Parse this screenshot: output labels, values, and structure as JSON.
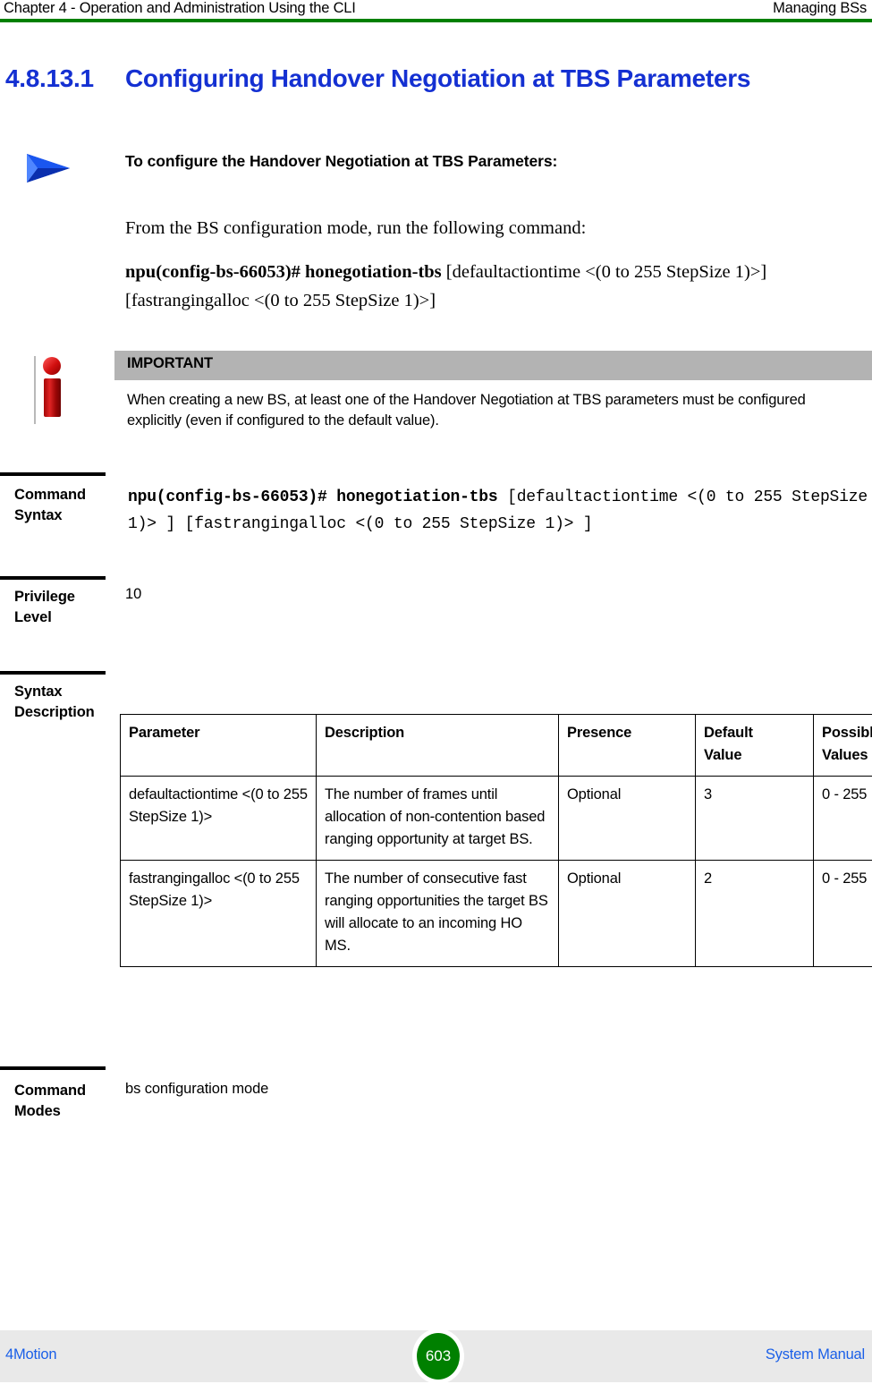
{
  "header": {
    "left": "Chapter 4 - Operation and Administration Using the CLI",
    "right": "Managing BSs",
    "rule_color": "#008000"
  },
  "section": {
    "number": "4.8.13.1",
    "title": "Configuring Handover Negotiation at TBS Parameters",
    "color": "#1430d2"
  },
  "procedure": {
    "arrow_icon": "blue-arrow-icon",
    "title": "To configure the Handover Negotiation at TBS Parameters:",
    "intro": "From the BS configuration mode, run the following command:",
    "command_bold": "npu(config-bs-66053)# honegotiation-tbs",
    "command_rest": " [defaultactiontime <(0 to 255 StepSize 1)>] [fastrangingalloc <(0 to 255 StepSize 1)>]"
  },
  "important_note": {
    "icon": "red-info-icon",
    "label": "IMPORTANT",
    "band_color": "#b3b3b3",
    "body": "When creating a new BS, at least one of the Handover Negotiation at TBS parameters must be configured explicitly (even if configured to the default value)."
  },
  "command_syntax": {
    "label_line1": "Command",
    "label_line2": "Syntax",
    "value_bold_1": "npu(config-bs-66053)#",
    "value_bold_2": "honegotiation-tbs",
    "value_rest": " [defaultactiontime <(0 to 255 StepSize 1)> ] [fastrangingalloc <(0 to 255 StepSize 1)> ]"
  },
  "privilege_level": {
    "label_line1": "Privilege",
    "label_line2": "Level",
    "value": "10"
  },
  "syntax_description": {
    "label_line1": "Syntax",
    "label_line2": "Description",
    "columns": [
      "Parameter",
      "Description",
      "Presence",
      "Default Value",
      "Possible Values"
    ],
    "column_headers": {
      "parameter": "Parameter",
      "description": "Description",
      "presence": "Presence",
      "default_value_line1": "Default",
      "default_value_line2": "Value",
      "possible_values_line1": "Possible",
      "possible_values_line2": "Values"
    },
    "rows": [
      {
        "parameter": "defaultactiontime <(0 to 255 StepSize 1)>",
        "description": "The number of frames until allocation of non-contention based ranging opportunity at target BS.",
        "presence": "Optional",
        "default_value": "3",
        "possible_values": "0 - 255"
      },
      {
        "parameter": "fastrangingalloc <(0 to 255 StepSize 1)>",
        "description": "The number of consecutive fast ranging opportunities the target BS will allocate to an incoming HO MS.",
        "presence": "Optional",
        "default_value": "2",
        "possible_values": "0 - 255"
      }
    ]
  },
  "command_modes": {
    "label_line1": "Command",
    "label_line2": "Modes",
    "value": "bs configuration mode"
  },
  "footer": {
    "left": "4Motion",
    "page_number": "603",
    "right": "System Manual",
    "badge_color": "#008000",
    "link_color": "#1a5fe8"
  }
}
